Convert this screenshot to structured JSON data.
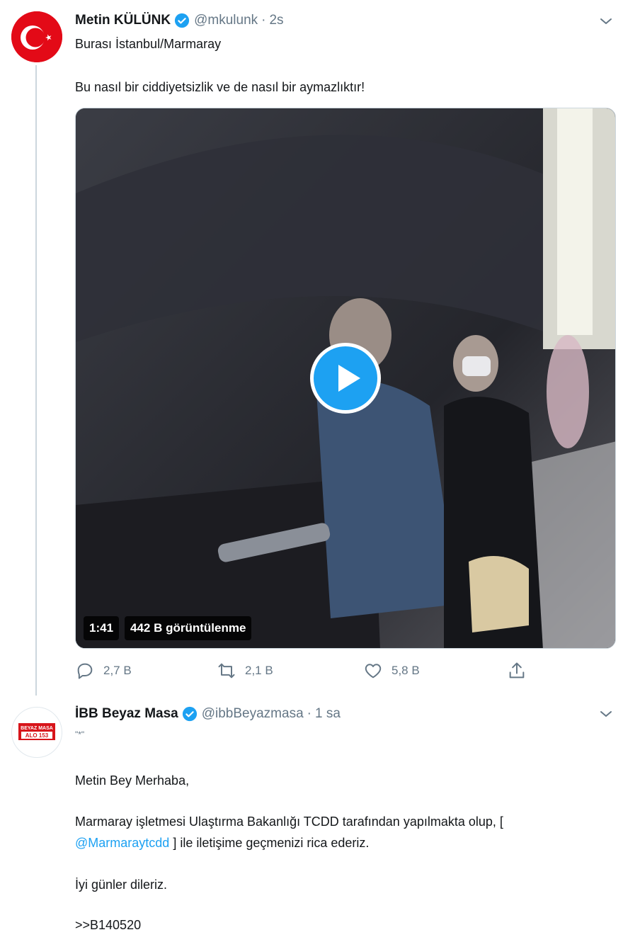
{
  "tweet1": {
    "name": "Metin KÜLÜNK",
    "handle": "@mkulunk",
    "separator": "·",
    "time": "2s",
    "line1": "Burası İstanbul/Marmaray",
    "line2": "Bu nasıl bir ciddiyetsizlik ve de nasıl bir aymazlıktır!",
    "video": {
      "duration": "1:41",
      "views": "442 B görüntülenme"
    },
    "actions": {
      "replies": "2,7 B",
      "retweets": "2,1 B",
      "likes": "5,8 B"
    }
  },
  "tweet2": {
    "name": "İBB Beyaz Masa",
    "handle": "@ibbBeyazmasa",
    "separator": "·",
    "time": "1 sa",
    "quote_mark": "\"*\"",
    "greeting": "Metin Bey Merhaba,",
    "body_line1": "Marmaray işletmesi Ulaştırma Bakanlığı TCDD tarafından yapılmakta olup, [",
    "mention": "@Marmaraytcdd",
    "body_line2_rest": " ] ile iletişime geçmenizi rica ederiz.",
    "closing": "İyi günler dileriz.",
    "code": ">>B140520",
    "avatar_logo_top": "BEYAZ MASA",
    "avatar_logo_bottom": "ALO 153"
  },
  "colors": {
    "accent": "#1da1f2",
    "secondary_text": "#657786",
    "flag_red": "#e30a17"
  },
  "icons": [
    "caret-down-icon",
    "verified-badge-icon",
    "play-icon",
    "reply-icon",
    "retweet-icon",
    "like-icon",
    "share-icon"
  ]
}
